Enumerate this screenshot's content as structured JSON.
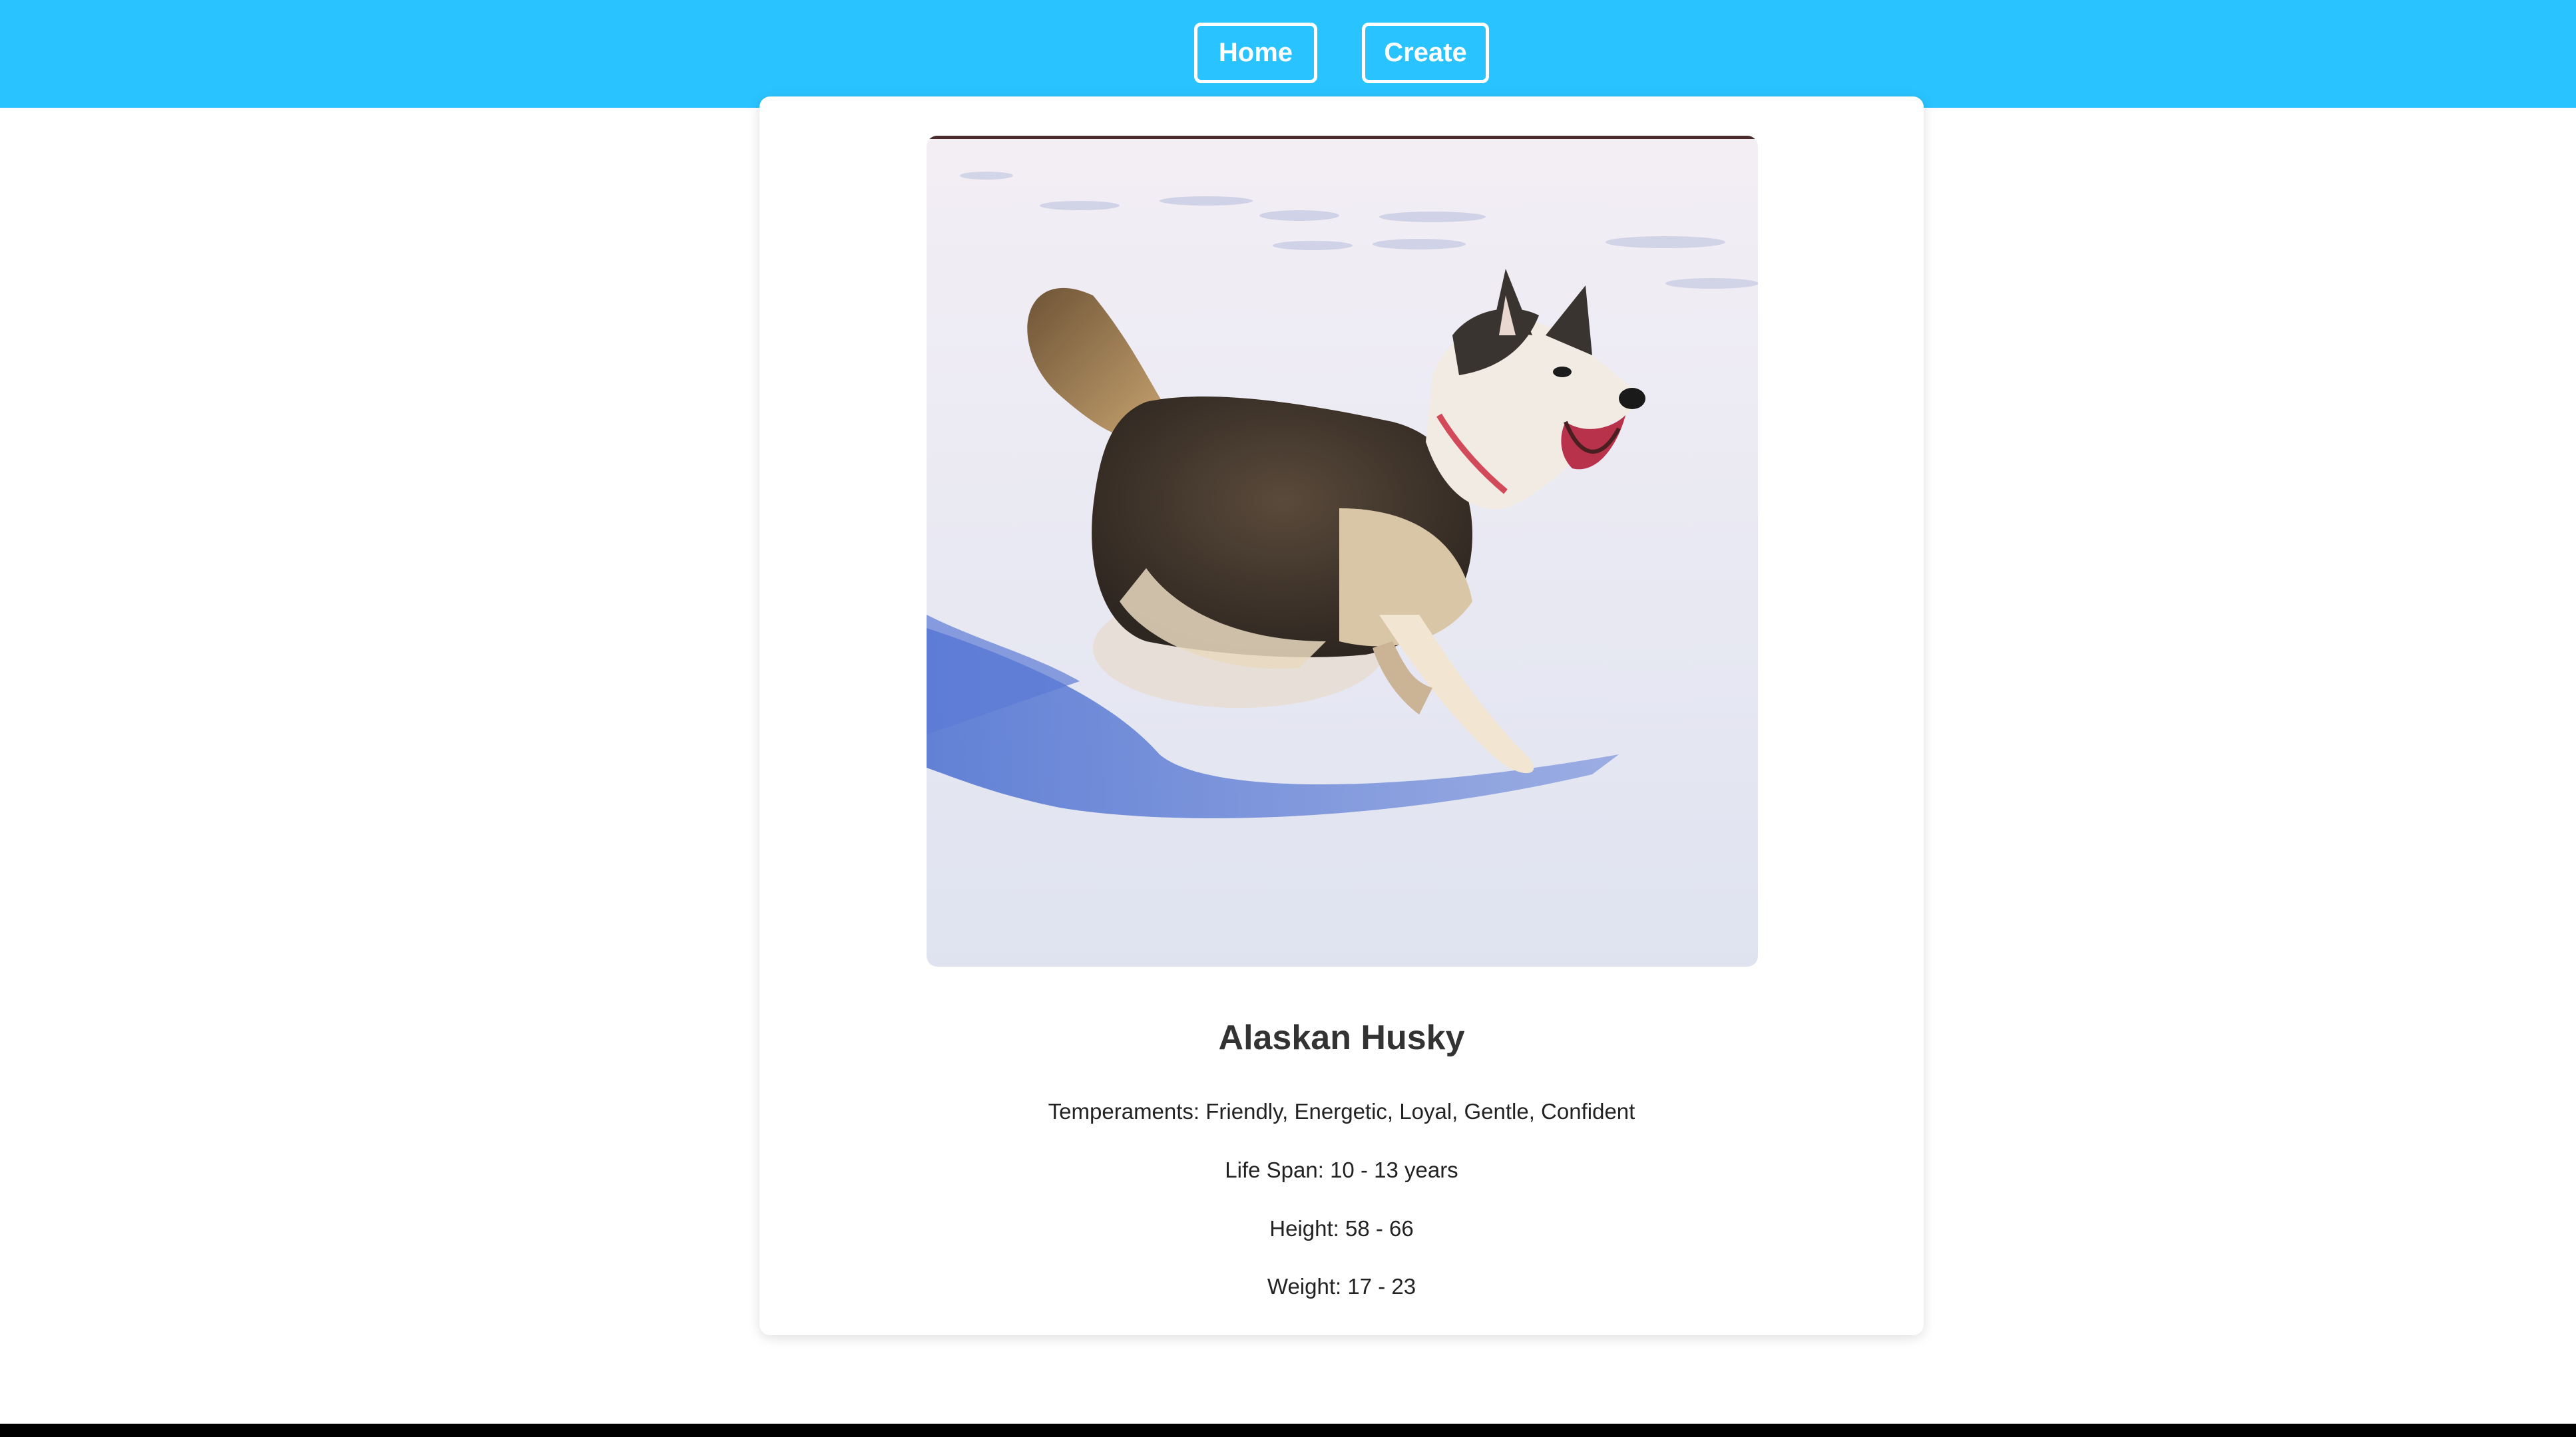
{
  "nav": {
    "home_label": "Home",
    "create_label": "Create"
  },
  "dog": {
    "name": "Alaskan Husky",
    "temperaments": "Temperaments: Friendly, Energetic, Loyal, Gentle, Confident",
    "life_span": "Life Span: 10 - 13 years",
    "height": "Height: 58 - 66",
    "weight": "Weight: 17 - 23"
  },
  "colors": {
    "navbar": "#29c3ff",
    "nav_text": "#ffffff",
    "title_text": "#333333"
  }
}
